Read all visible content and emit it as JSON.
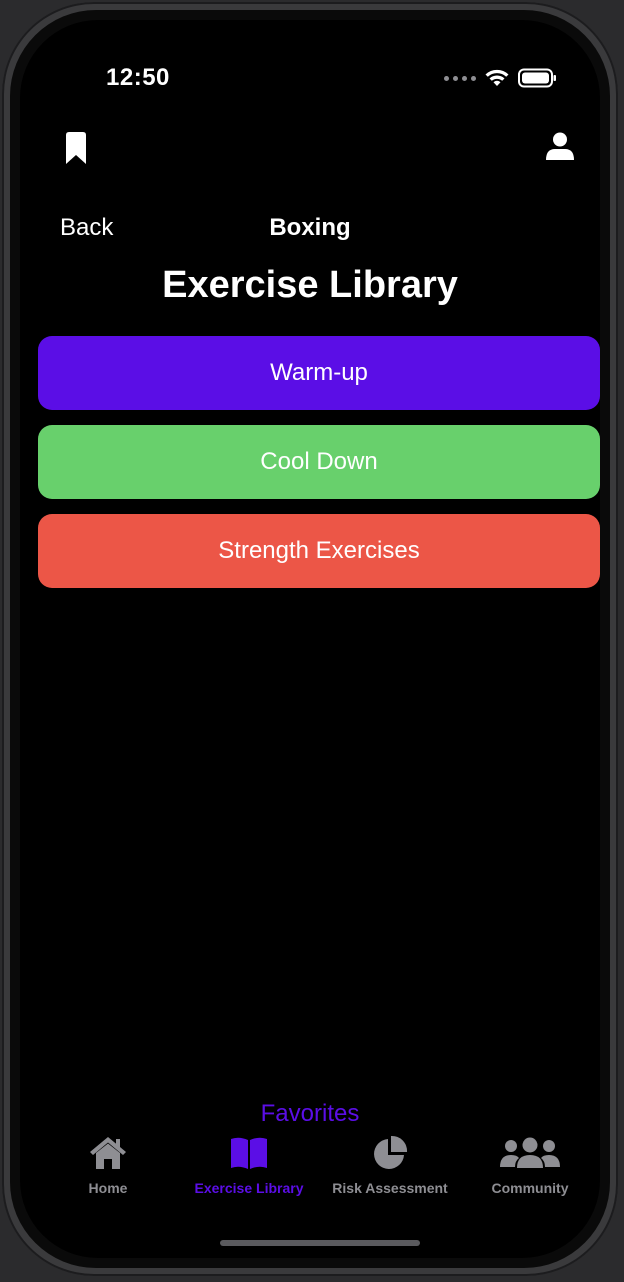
{
  "status_bar": {
    "time": "12:50"
  },
  "header": {
    "bookmark_icon": "bookmark-icon",
    "profile_icon": "person-icon"
  },
  "nav": {
    "back_label": "Back",
    "title": "Boxing"
  },
  "page": {
    "title": "Exercise Library"
  },
  "categories": [
    {
      "label": "Warm-up",
      "color": "#5b0ee6"
    },
    {
      "label": "Cool Down",
      "color": "#68d06c"
    },
    {
      "label": "Strength Exercises",
      "color": "#ec5647"
    }
  ],
  "favorites": {
    "label": "Favorites",
    "color": "#5b0ee6"
  },
  "tabbar": {
    "active_color": "#5b0ee6",
    "inactive_color": "#8e8e93",
    "tabs": [
      {
        "label": "Home",
        "icon": "house-icon",
        "active": false
      },
      {
        "label": "Exercise Library",
        "icon": "book-open-icon",
        "active": true
      },
      {
        "label": "Risk Assessment",
        "icon": "chart-pie-icon",
        "active": false
      },
      {
        "label": "Community",
        "icon": "users-icon",
        "active": false
      }
    ]
  }
}
